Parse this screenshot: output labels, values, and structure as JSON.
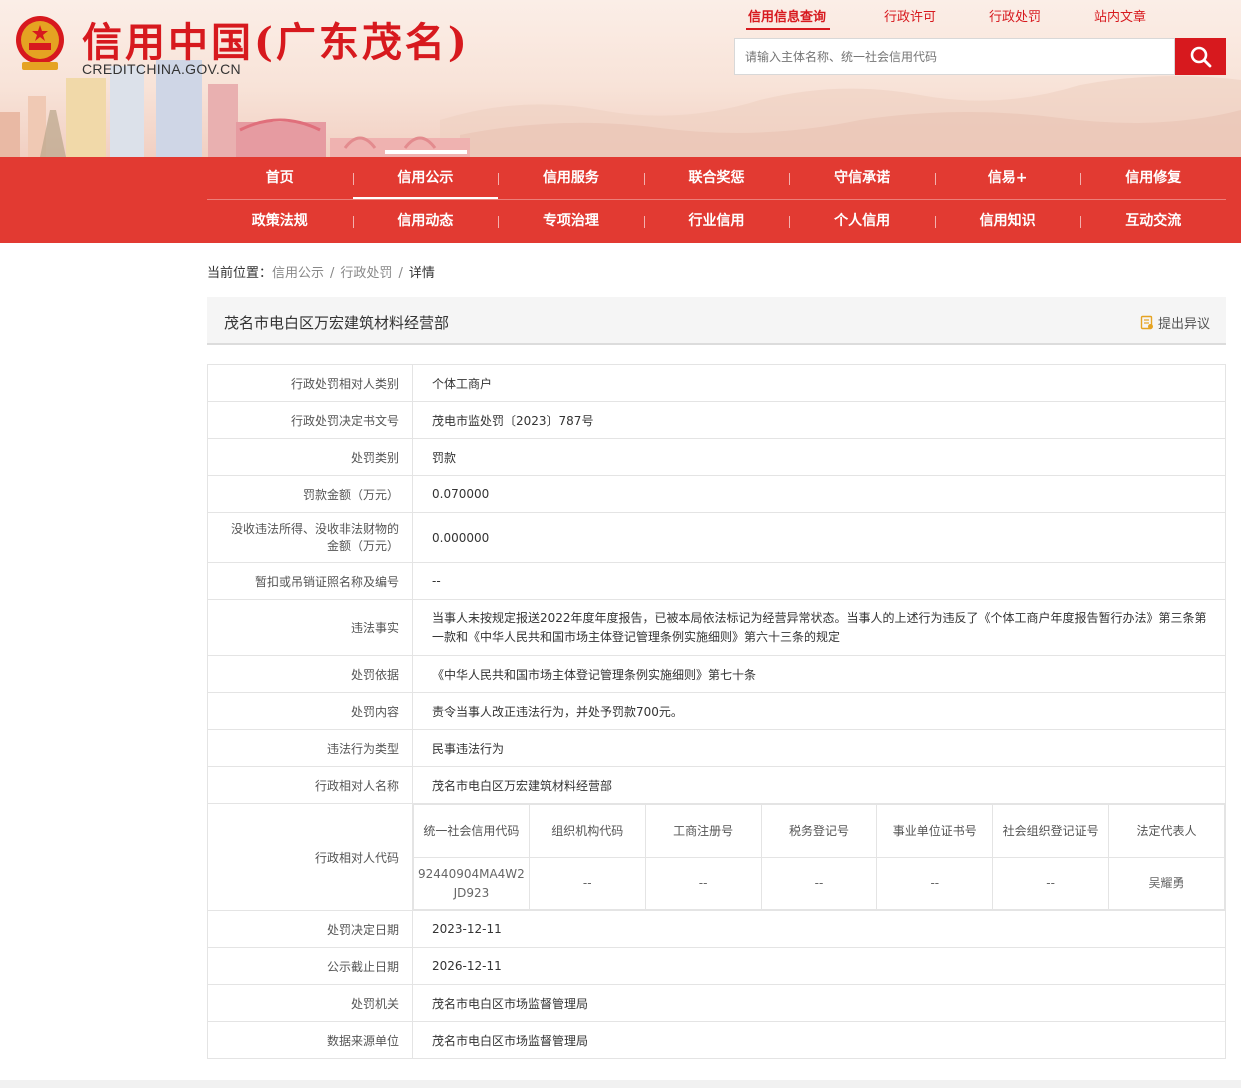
{
  "header": {
    "site_title": "信用中国(广东茂名)",
    "site_domain": "CREDITCHINA.GOV.CN",
    "top_links": [
      {
        "label": "信用信息查询",
        "active": true
      },
      {
        "label": "行政许可",
        "active": false
      },
      {
        "label": "行政处罚",
        "active": false
      },
      {
        "label": "站内文章",
        "active": false
      }
    ],
    "search_placeholder": "请输入主体名称、统一社会信用代码",
    "brand_color": "#d7191e",
    "nav_color": "#e23a32"
  },
  "nav": {
    "row1": [
      "首页",
      "信用公示",
      "信用服务",
      "联合奖惩",
      "守信承诺",
      "信易+",
      "信用修复"
    ],
    "row2": [
      "政策法规",
      "信用动态",
      "专项治理",
      "行业信用",
      "个人信用",
      "信用知识",
      "互动交流"
    ],
    "active": "信用公示"
  },
  "breadcrumb": {
    "prefix": "当前位置：",
    "items": [
      "信用公示",
      "行政处罚",
      "详情"
    ],
    "separator": "/"
  },
  "record": {
    "title": "茂名市电白区万宏建筑材料经营部",
    "objection_label": "提出异议",
    "rows_before": [
      {
        "label": "行政处罚相对人类别",
        "value": "个体工商户"
      },
      {
        "label": "行政处罚决定书文号",
        "value": "茂电市监处罚〔2023〕787号"
      },
      {
        "label": "处罚类别",
        "value": "罚款"
      },
      {
        "label": "罚款金额（万元）",
        "value": "0.070000"
      },
      {
        "label": "没收违法所得、没收非法财物的金额（万元）",
        "value": "0.000000"
      },
      {
        "label": "暂扣或吊销证照名称及编号",
        "value": "--"
      },
      {
        "label": "违法事实",
        "value": "当事人未按规定报送2022年度年度报告，已被本局依法标记为经营异常状态。当事人的上述行为违反了《个体工商户年度报告暂行办法》第三条第一款和《中华人民共和国市场主体登记管理条例实施细则》第六十三条的规定"
      },
      {
        "label": "处罚依据",
        "value": "《中华人民共和国市场主体登记管理条例实施细则》第七十条"
      },
      {
        "label": "处罚内容",
        "value": "责令当事人改正违法行为，并处予罚款700元。"
      },
      {
        "label": "违法行为类型",
        "value": "民事违法行为"
      },
      {
        "label": "行政相对人名称",
        "value": "茂名市电白区万宏建筑材料经营部"
      }
    ],
    "codes": {
      "label": "行政相对人代码",
      "headers": [
        "统一社会信用代码",
        "组织机构代码",
        "工商注册号",
        "税务登记号",
        "事业单位证书号",
        "社会组织登记证号",
        "法定代表人"
      ],
      "values": [
        "92440904MA4W2JD923",
        "--",
        "--",
        "--",
        "--",
        "--",
        "吴耀勇"
      ]
    },
    "rows_after": [
      {
        "label": "处罚决定日期",
        "value": "2023-12-11"
      },
      {
        "label": "公示截止日期",
        "value": "2026-12-11"
      },
      {
        "label": "处罚机关",
        "value": "茂名市电白区市场监督管理局"
      },
      {
        "label": "数据来源单位",
        "value": "茂名市电白区市场监督管理局"
      }
    ]
  }
}
